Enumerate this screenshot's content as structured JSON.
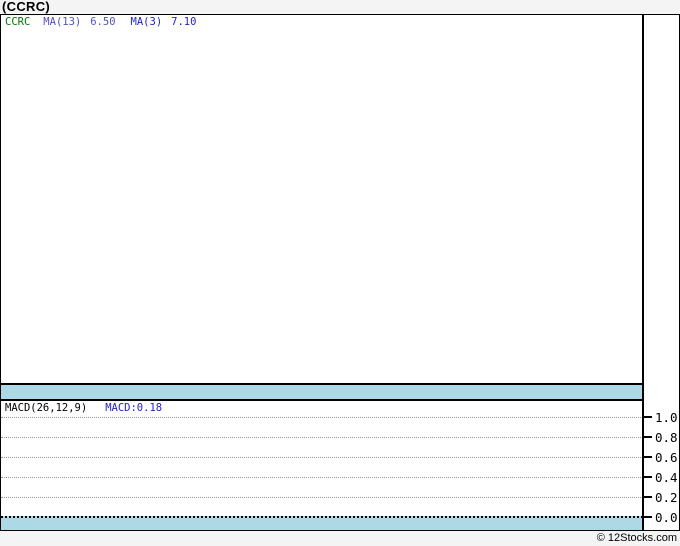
{
  "title": {
    "text": "(CCRC)"
  },
  "price_panel": {
    "legend": {
      "ticker": "CCRC",
      "ma13_label": "MA(13)",
      "ma13_value": "6.50",
      "ma3_label": "MA(3)",
      "ma3_value": "7.10"
    }
  },
  "macd_panel": {
    "legend_label": "MACD(26,12,9)",
    "legend_value": "MACD:0.18",
    "ticks": [
      "1.0",
      "0.8",
      "0.6",
      "0.4",
      "0.2",
      "0.0"
    ]
  },
  "footer": {
    "watermark": "© 12Stocks.com"
  },
  "colors": {
    "band_blue": "#add8e6",
    "ticker_green": "#007700",
    "ma13_blue": "#5050c8",
    "ma3_blue": "#2222cc",
    "macd_value_blue": "#2222cc",
    "page_bg": "#f4f4f4",
    "grid_gray": "#999999",
    "border_black": "#000000"
  },
  "chart_data": [
    {
      "type": "line",
      "title": "(CCRC)",
      "panel": "price",
      "series": [
        {
          "name": "CCRC",
          "color": "#007700",
          "values": []
        },
        {
          "name": "MA(13)",
          "color": "#5050c8",
          "last_value": 6.5,
          "values": []
        },
        {
          "name": "MA(3)",
          "color": "#2222cc",
          "last_value": 7.1,
          "values": []
        }
      ],
      "x": [],
      "grid": false,
      "legend_position": "top-left",
      "note": "plot area renders empty/blank in screenshot; only legend values visible"
    },
    {
      "type": "line",
      "panel": "MACD(26,12,9)",
      "series": [
        {
          "name": "MACD",
          "color": "#2222cc",
          "last_value": 0.18,
          "values": []
        }
      ],
      "x": [],
      "ylim": [
        0.0,
        1.0
      ],
      "yticks": [
        1.0,
        0.8,
        0.6,
        0.4,
        0.2,
        0.0
      ],
      "grid": true,
      "legend_position": "top-left",
      "note": "no MACD curve visible in plot area; zero line is dark dotted above bottom band"
    }
  ]
}
